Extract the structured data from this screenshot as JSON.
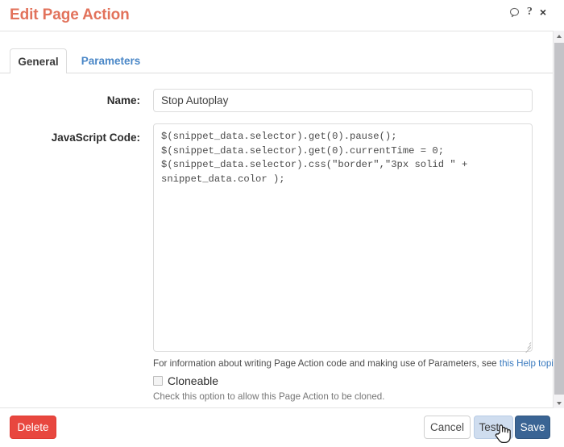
{
  "header": {
    "title": "Edit Page Action",
    "title_color": "#e2725b",
    "icons": [
      {
        "name": "comment-icon",
        "glyph": "comment"
      },
      {
        "name": "help-icon",
        "glyph": "?"
      },
      {
        "name": "close-icon",
        "glyph": "×"
      }
    ]
  },
  "tabs": [
    {
      "label": "General",
      "active": true
    },
    {
      "label": "Parameters",
      "active": false
    }
  ],
  "form": {
    "name_label": "Name:",
    "name_value": "Stop Autoplay",
    "name_placeholder": "",
    "code_label": "JavaScript Code:",
    "code_value": "$(snippet_data.selector).get(0).pause();\n$(snippet_data.selector).get(0).currentTime = 0;\n$(snippet_data.selector).css(\"border\",\"3px solid \" +\nsnippet_data.color );",
    "code_placeholder": "",
    "help_text_prefix": "For information about writing Page Action code and making use of Parameters, see ",
    "help_link_text": "this Help topic",
    "help_text_suffix": ".",
    "cloneable_label": "Cloneable",
    "cloneable_checked": false,
    "cloneable_help": "Check this option to allow this Page Action to be cloned."
  },
  "footer": {
    "delete_label": "Delete",
    "cancel_label": "Cancel",
    "test_label": "Test...",
    "save_label": "Save"
  },
  "colors": {
    "title": "#e2725b",
    "delete": "#e8473f",
    "save": "#3a6494",
    "test_hover": "#cfddef",
    "link": "#3b7bbf",
    "tab_inactive": "#4a87c7"
  }
}
